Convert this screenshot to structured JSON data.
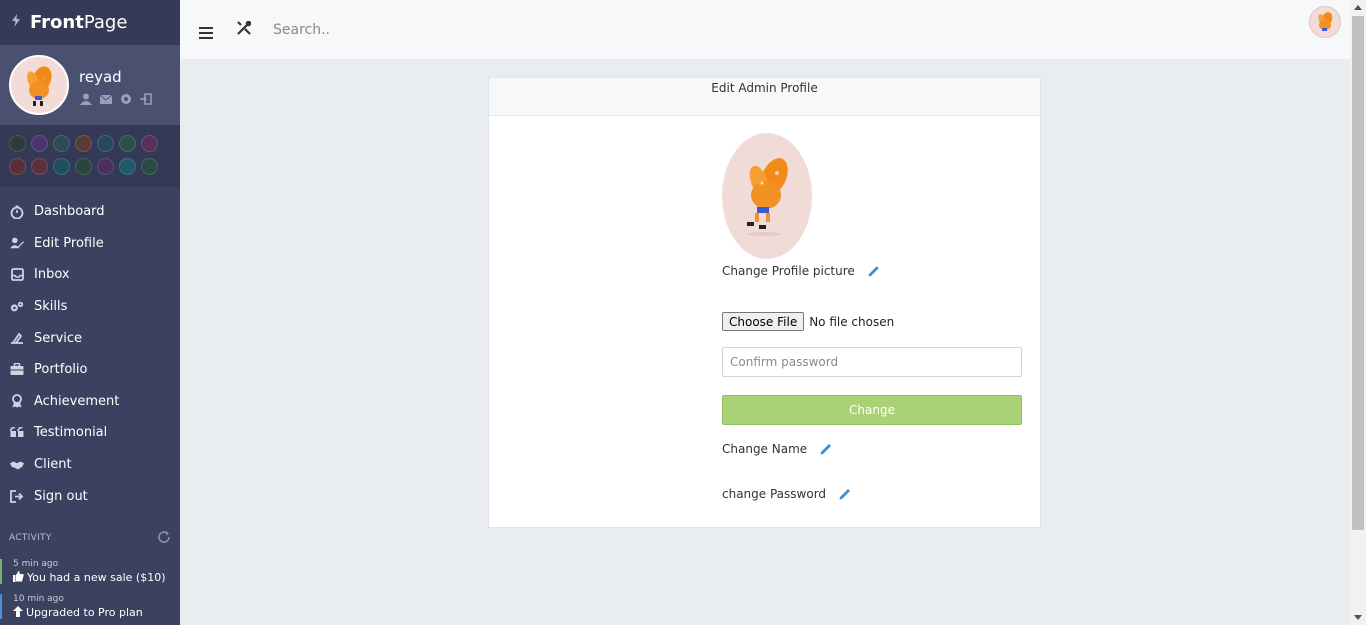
{
  "brand": {
    "bold": "Front",
    "light": "Page"
  },
  "user": {
    "name": "reyad"
  },
  "swatches": {
    "row1": [
      "#2e3a3c",
      "#4a3570",
      "#2e4a52",
      "#5a3a34",
      "#274a5a",
      "#2c5048",
      "#5a2f5a"
    ],
    "row2": [
      "#5a2f3a",
      "#5a3040",
      "#1f5060",
      "#28463e",
      "#4a2f60",
      "#1f5a68",
      "#2a4a48"
    ]
  },
  "nav": {
    "items": [
      {
        "label": "Dashboard",
        "icon": "timer-icon"
      },
      {
        "label": "Edit Profile",
        "icon": "user-edit-icon"
      },
      {
        "label": "Inbox",
        "icon": "inbox-icon"
      },
      {
        "label": "Skills",
        "icon": "gears-icon"
      },
      {
        "label": "Service",
        "icon": "service-icon"
      },
      {
        "label": "Portfolio",
        "icon": "briefcase-icon"
      },
      {
        "label": "Achievement",
        "icon": "award-icon"
      },
      {
        "label": "Testimonial",
        "icon": "quote-icon"
      },
      {
        "label": "Client",
        "icon": "handshake-icon"
      },
      {
        "label": "Sign out",
        "icon": "sign-out-icon"
      }
    ]
  },
  "activity": {
    "label": "ACTIVITY",
    "items": [
      {
        "time": "5 min ago",
        "message": "You had a new sale ($10)"
      },
      {
        "time": "10 min ago",
        "message": "Upgraded to Pro plan"
      }
    ]
  },
  "search": {
    "placeholder": "Search.."
  },
  "card": {
    "title": "Edit Admin Profile",
    "change_picture_label": "Change Profile picture",
    "file_button": "Choose File",
    "file_status": "No file chosen",
    "password_placeholder": "Confirm password",
    "change_button": "Change",
    "change_name_label": "Change Name",
    "change_password_label": "change Password"
  },
  "colors": {
    "sidebar": "#3b4260",
    "accent_green": "#a8d275",
    "pencil_blue": "#3d8fd1"
  }
}
